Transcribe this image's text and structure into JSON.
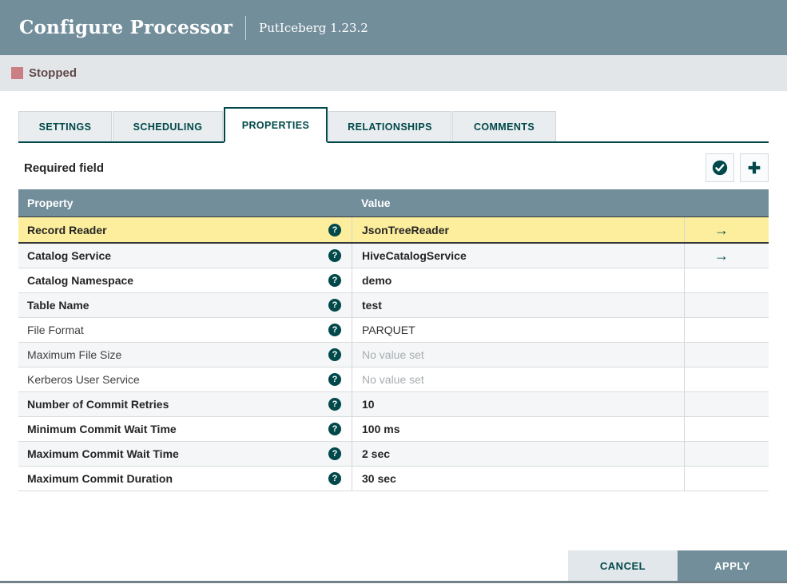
{
  "dialog": {
    "title": "Configure Processor",
    "subtitle": "PutIceberg 1.23.2"
  },
  "status": {
    "label": "Stopped",
    "color": "#cb7e84"
  },
  "tabs": {
    "items": [
      {
        "label": "SETTINGS",
        "active": false
      },
      {
        "label": "SCHEDULING",
        "active": false
      },
      {
        "label": "PROPERTIES",
        "active": true
      },
      {
        "label": "RELATIONSHIPS",
        "active": false
      },
      {
        "label": "COMMENTS",
        "active": false
      }
    ]
  },
  "toolbar": {
    "required_label": "Required field",
    "buttons": [
      {
        "name": "verify-properties",
        "icon": "check-circle-icon"
      },
      {
        "name": "add-property",
        "icon": "plus-icon"
      }
    ]
  },
  "icons": {
    "help": "?",
    "go_to_service": "→"
  },
  "table": {
    "columns": [
      "Property",
      "Value"
    ],
    "rows": [
      {
        "name": "Record Reader",
        "required": true,
        "value": "JsonTreeReader",
        "value_state": "set",
        "has_arrow": true,
        "selected": true
      },
      {
        "name": "Catalog Service",
        "required": true,
        "value": "HiveCatalogService",
        "value_state": "set",
        "has_arrow": true,
        "selected": false
      },
      {
        "name": "Catalog Namespace",
        "required": true,
        "value": "demo",
        "value_state": "set",
        "has_arrow": false,
        "selected": false
      },
      {
        "name": "Table Name",
        "required": true,
        "value": "test",
        "value_state": "set",
        "has_arrow": false,
        "selected": false
      },
      {
        "name": "File Format",
        "required": false,
        "value": "PARQUET",
        "value_state": "default",
        "has_arrow": false,
        "selected": false
      },
      {
        "name": "Maximum File Size",
        "required": false,
        "value": "No value set",
        "value_state": "unset",
        "has_arrow": false,
        "selected": false
      },
      {
        "name": "Kerberos User Service",
        "required": false,
        "value": "No value set",
        "value_state": "unset",
        "has_arrow": false,
        "selected": false
      },
      {
        "name": "Number of Commit Retries",
        "required": true,
        "value": "10",
        "value_state": "set",
        "has_arrow": false,
        "selected": false
      },
      {
        "name": "Minimum Commit Wait Time",
        "required": true,
        "value": "100 ms",
        "value_state": "set",
        "has_arrow": false,
        "selected": false
      },
      {
        "name": "Maximum Commit Wait Time",
        "required": true,
        "value": "2 sec",
        "value_state": "set",
        "has_arrow": false,
        "selected": false
      },
      {
        "name": "Maximum Commit Duration",
        "required": true,
        "value": "30 sec",
        "value_state": "set",
        "has_arrow": false,
        "selected": false
      }
    ]
  },
  "footer": {
    "cancel_label": "CANCEL",
    "apply_label": "APPLY"
  },
  "colors": {
    "header_bg": "#728e9b",
    "accent": "#004849",
    "selected_row": "#fcee9c",
    "stopped": "#cb7e84"
  }
}
